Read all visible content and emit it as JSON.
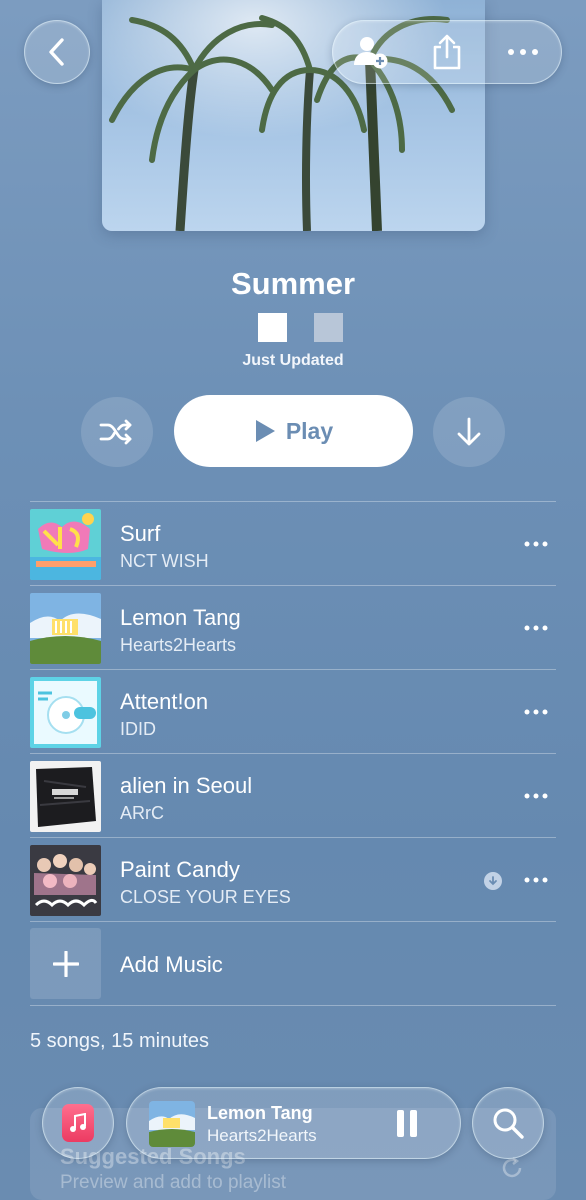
{
  "playlist": {
    "title": "Summer",
    "status": "Just Updated"
  },
  "top_bar": {
    "back_icon": "chevron-left-icon",
    "actions": [
      "add-collaborator-icon",
      "share-icon",
      "more-icon"
    ]
  },
  "controls": {
    "play_label": "Play",
    "shuffle_icon": "shuffle-icon",
    "download_icon": "download-arrow-icon"
  },
  "songs": [
    {
      "title": "Surf",
      "artist": "NCT WISH",
      "downloaded": false
    },
    {
      "title": "Lemon Tang",
      "artist": "Hearts2Hearts",
      "downloaded": false
    },
    {
      "title": "Attent!on",
      "artist": "IDID",
      "downloaded": false
    },
    {
      "title": "alien in Seoul",
      "artist": "ARrC",
      "downloaded": false
    },
    {
      "title": "Paint Candy",
      "artist": "CLOSE YOUR EYES",
      "downloaded": true
    }
  ],
  "add_music_label": "Add Music",
  "summary": "5 songs, 15 minutes",
  "suggested": {
    "title": "Suggested Songs",
    "subtitle": "Preview and add to playlist"
  },
  "now_playing": {
    "title": "Lemon Tang",
    "artist": "Hearts2Hearts"
  },
  "colors": {
    "background": "#6a8db2",
    "play_button_text": "#6b8db3",
    "music_app_icon": "#ec3b62"
  }
}
